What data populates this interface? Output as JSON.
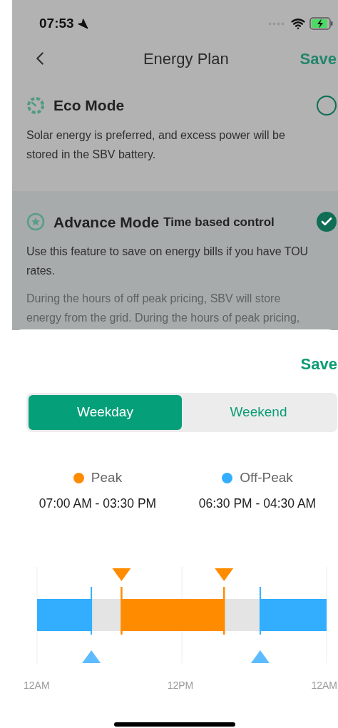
{
  "status_bar": {
    "time": "07:53"
  },
  "header": {
    "title": "Energy Plan",
    "save": "Save"
  },
  "modes": [
    {
      "kind": "eco",
      "title": "Eco Mode",
      "selected": false,
      "paragraphs": [
        {
          "text": "Solar energy is preferred, and excess power will be stored in the SBV battery.",
          "muted": false
        }
      ]
    },
    {
      "kind": "advance",
      "title": "Advance Mode",
      "tag": "Time based control",
      "selected": true,
      "paragraphs": [
        {
          "text": "Use this feature to save on energy bills if you have TOU rates.",
          "muted": false
        },
        {
          "text": "During the hours of off peak pricing, SBV will store energy from the grid. During the hours of peak pricing,",
          "muted": true
        }
      ]
    }
  ],
  "sheet": {
    "save": "Save",
    "tabs": [
      {
        "label": "Weekday",
        "selected": true
      },
      {
        "label": "Weekend",
        "selected": false
      }
    ],
    "legend": [
      {
        "kind": "peak",
        "label": "Peak",
        "color": "#ff8c00",
        "range": "07:00 AM - 03:30 PM"
      },
      {
        "kind": "off_peak",
        "label": "Off-Peak",
        "color": "#33aeff",
        "range": "06:30 PM - 04:30 AM"
      }
    ],
    "timeline": {
      "markers": [
        {
          "kind": "off_peak",
          "level": 0.1875
        },
        {
          "kind": "peak",
          "level": 0.2917
        },
        {
          "kind": "peak",
          "level": 0.6458
        },
        {
          "kind": "off_peak",
          "level": 0.7708
        }
      ],
      "axis_labels": [
        "12AM",
        "12PM",
        "12AM"
      ]
    }
  }
}
